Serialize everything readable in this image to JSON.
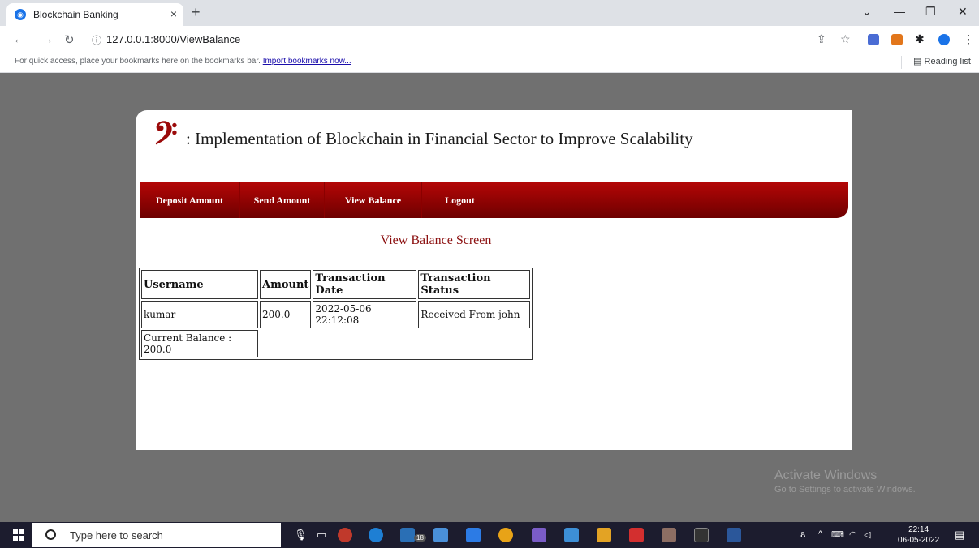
{
  "browser": {
    "tab_title": "Blockchain Banking",
    "tab_close": "×",
    "new_tab": "+",
    "url": "127.0.0.1:8000/ViewBalance",
    "bookmarks_text": "For quick access, place your bookmarks here on the bookmarks bar.",
    "bookmarks_link": "Import bookmarks now...",
    "reading_list": "Reading list"
  },
  "site": {
    "logo_glyph": "𝄢",
    "title": ": Implementation of Blockchain in Financial Sector to Improve Scalability"
  },
  "menu": {
    "items": [
      "Deposit Amount",
      "Send Amount",
      "View Balance",
      "Logout"
    ]
  },
  "screen_title": "View Balance Screen",
  "table": {
    "headers": [
      "Username",
      "Amount",
      "Transaction Date",
      "Transaction Status"
    ],
    "rows": [
      [
        "kumar",
        "200.0",
        "2022-05-06 22:12:08",
        "Received From john"
      ]
    ],
    "balance_label": "Current Balance : 200.0"
  },
  "watermark": {
    "title": "Activate Windows",
    "subtitle": "Go to Settings to activate Windows."
  },
  "taskbar": {
    "search_placeholder": "Type here to search",
    "badge_count": "18",
    "time": "22:14",
    "date": "06-05-2022"
  },
  "colors": {
    "menu_top": "#b30606",
    "menu_bottom": "#6e0000",
    "accent": "#8b0f0f"
  }
}
